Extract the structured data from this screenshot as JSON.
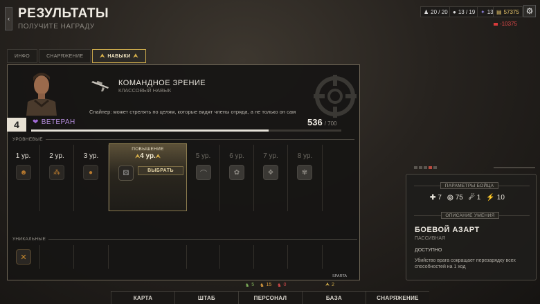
{
  "header": {
    "title": "РЕЗУЛЬТАТЫ",
    "subtitle": "ПОЛУЧИТЕ НАГРАДУ"
  },
  "resources": [
    {
      "icon": "soldier-icon",
      "value": "20 / 20"
    },
    {
      "icon": "person-icon",
      "value": "13 / 19"
    },
    {
      "icon": "intel-icon",
      "value": "13"
    },
    {
      "icon": "money-icon",
      "value": "57375"
    }
  ],
  "debt": {
    "value": "-10375"
  },
  "tabs": [
    {
      "label": "ИНФО"
    },
    {
      "label": "СНАРЯЖЕНИЕ"
    },
    {
      "label": "НАВЫКИ"
    }
  ],
  "skill": {
    "name": "КОМАНДНОЕ ЗРЕНИЕ",
    "type": "КЛАССОВЫЙ НАВЫК",
    "description": "Снайпер: может стрелять по целям, которые видят члены отряда, а не только он сам"
  },
  "soldier": {
    "level": "4",
    "rank": "ВЕТЕРАН",
    "xp": "536",
    "xp_max": "/ 700",
    "xp_progress": 0.766
  },
  "sections": {
    "level": "УРОВНЕВЫЕ",
    "unique": "УНИКАЛЬНЫЕ"
  },
  "levels": [
    {
      "label": "1 ур."
    },
    {
      "label": "2 ур."
    },
    {
      "label": "3 ур."
    },
    {
      "label": "5 ур."
    },
    {
      "label": "6 ур."
    },
    {
      "label": "7 ур."
    },
    {
      "label": "8 ур."
    }
  ],
  "promotion": {
    "title": "ПОВЫШЕНИЕ",
    "level": "4 ур.",
    "button": "ВЫБРАТЬ"
  },
  "corner_label": "SPARTA",
  "fighter": {
    "params_title": "ПАРАМЕТРЫ БОЙЦА",
    "stats": [
      {
        "icon": "health-icon",
        "value": "7"
      },
      {
        "icon": "aim-icon",
        "value": "75"
      },
      {
        "icon": "speed-icon",
        "value": "1"
      },
      {
        "icon": "move-icon",
        "value": "10"
      }
    ],
    "ability_title": "ОПИСАНИЕ УМЕНИЯ",
    "ability_name": "БОЕВОЙ АЗАРТ",
    "ability_type": "ПАССИВНАЯ",
    "ability_status": "ДОСТУПНО",
    "ability_desc": "Убийство врага сокращает перезарядку всех способностей на 1 ход"
  },
  "counters": [
    {
      "value": "5",
      "color": "#7fb05a"
    },
    {
      "value": "15",
      "color": "#e0a040"
    },
    {
      "value": "0",
      "color": "#d84a4a"
    },
    {
      "value": "2",
      "color": "#d9b24c"
    }
  ],
  "nav": [
    {
      "label": "КАРТА"
    },
    {
      "label": "ШТАБ"
    },
    {
      "label": "ПЕРСОНАЛ"
    },
    {
      "label": "БАЗА"
    },
    {
      "label": "СНАРЯЖЕНИЕ"
    }
  ]
}
